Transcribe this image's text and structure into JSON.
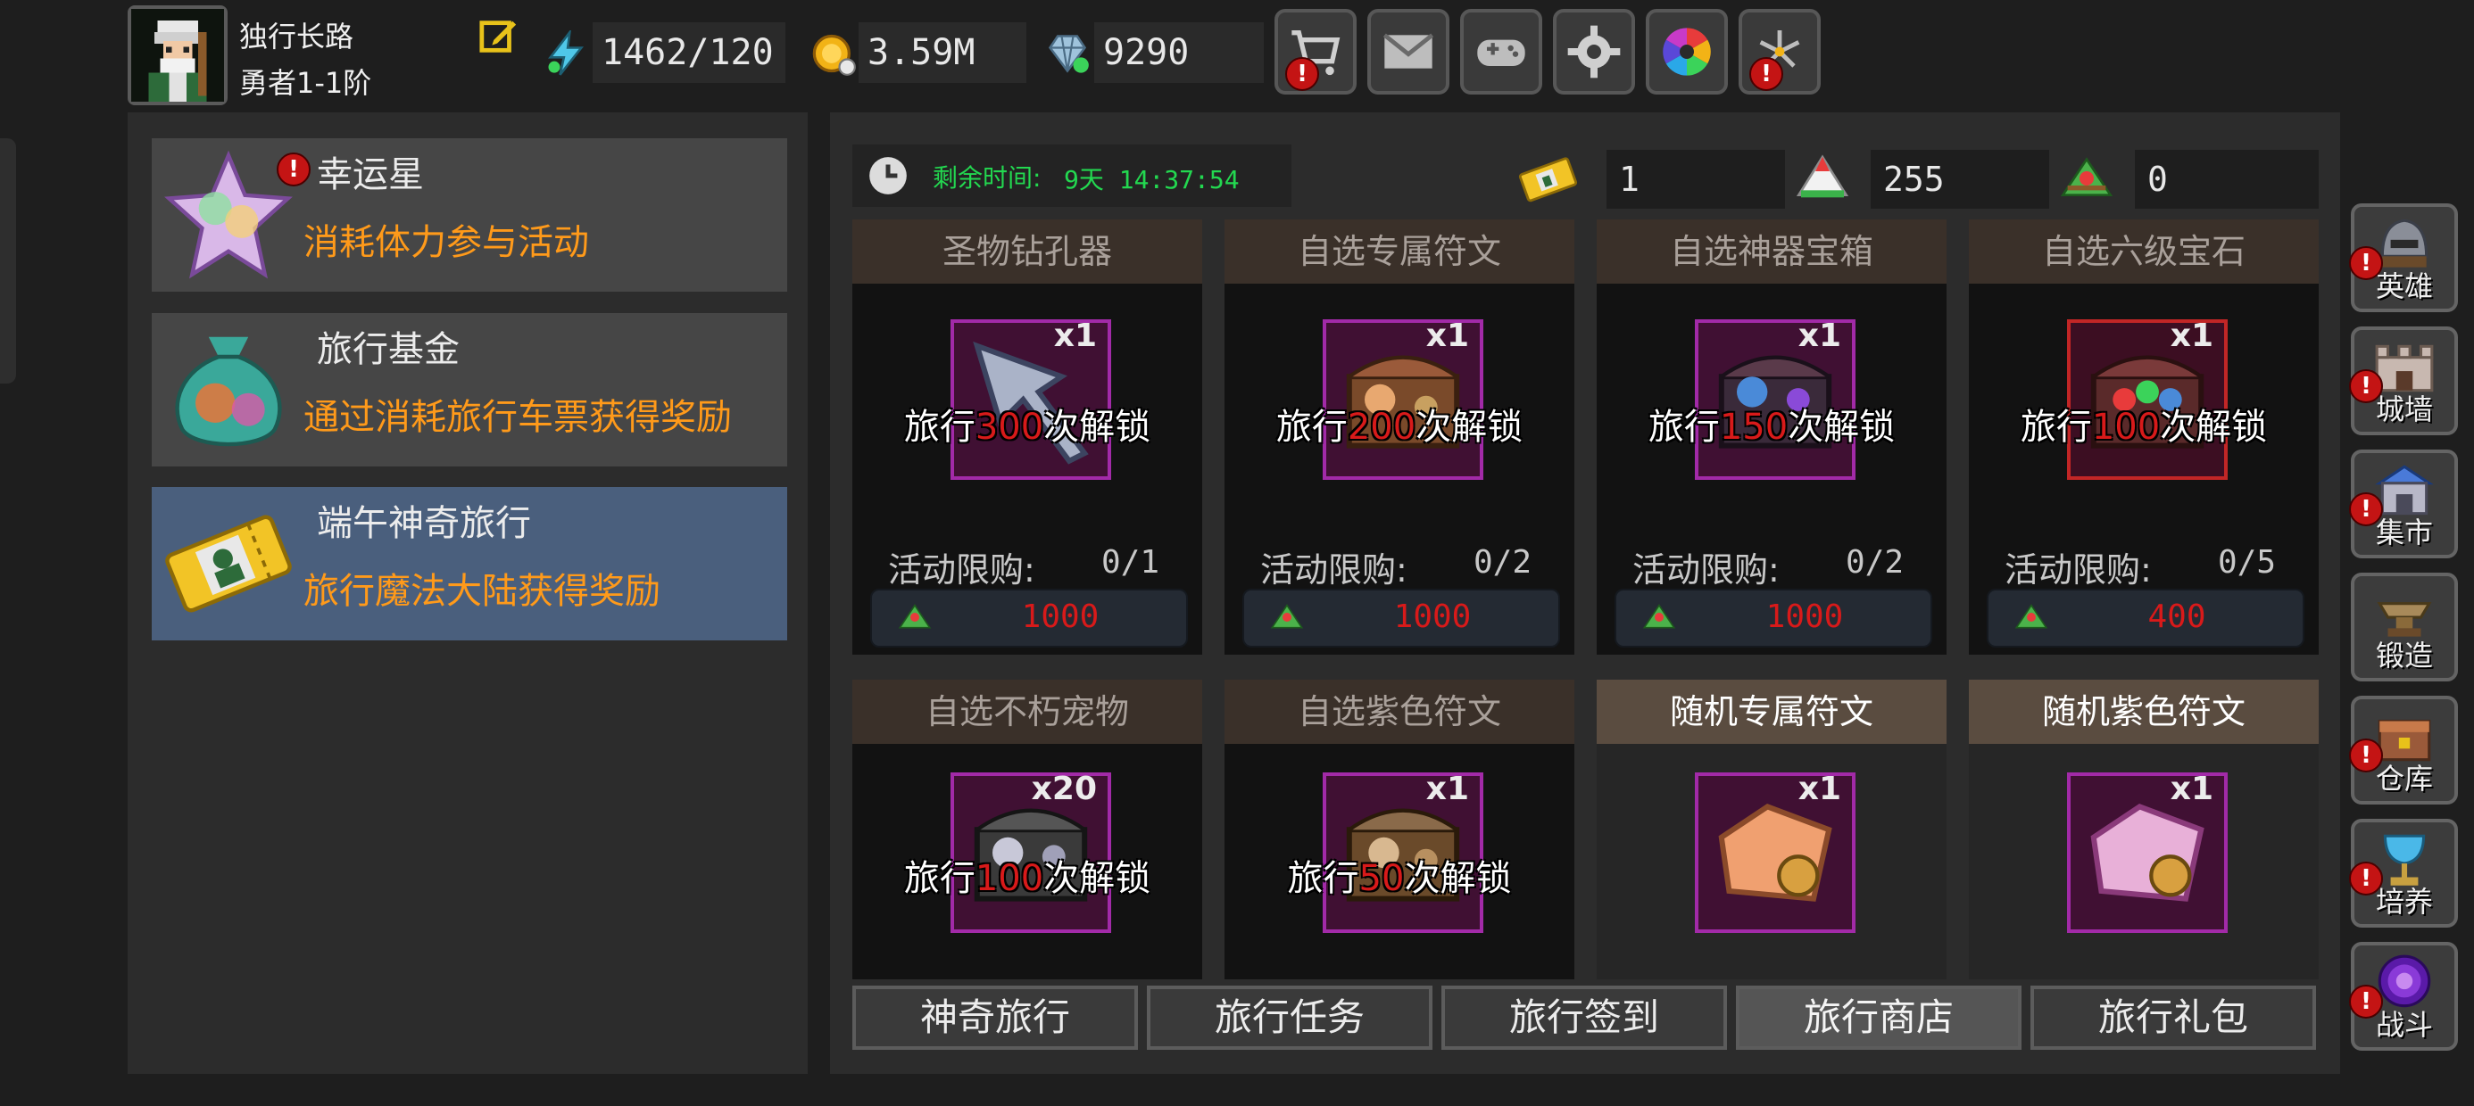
{
  "player": {
    "name": "独行长路",
    "rank": "勇者1-1阶"
  },
  "resources": [
    {
      "icon": "stamina-icon",
      "value": "1462/120"
    },
    {
      "icon": "gold-coin-icon",
      "value": "3.59M"
    },
    {
      "icon": "diamond-icon",
      "value": "9290"
    }
  ],
  "top_buttons": [
    {
      "icon": "cart-icon",
      "alert": "!"
    },
    {
      "icon": "mail-icon",
      "alert": ""
    },
    {
      "icon": "gamepad-icon",
      "alert": ""
    },
    {
      "icon": "settings-gear-icon",
      "alert": ""
    },
    {
      "icon": "color-wheel-icon",
      "alert": ""
    },
    {
      "icon": "fireworks-icon",
      "alert": "!"
    }
  ],
  "events": [
    {
      "title": "幸运星",
      "desc": "消耗体力参与活动",
      "icon": "lucky-star-icon",
      "alert": "!",
      "active": false
    },
    {
      "title": "旅行基金",
      "desc": "通过消耗旅行车票获得奖励",
      "icon": "money-bag-icon",
      "alert": "",
      "active": false
    },
    {
      "title": "端午神奇旅行",
      "desc": "旅行魔法大陆获得奖励",
      "icon": "travel-ticket-icon",
      "alert": "",
      "active": true
    }
  ],
  "timer": {
    "label": "剩余时间:",
    "value": "9天 14:37:54"
  },
  "currencies": [
    {
      "icon": "ticket-icon",
      "value": "1"
    },
    {
      "icon": "rice-dumpling-icon",
      "value": "255"
    },
    {
      "icon": "zongzi-icon",
      "value": "0"
    }
  ],
  "shop_items": [
    {
      "name": "圣物钻孔器",
      "qty": "x1",
      "lock_prefix": "旅行",
      "lock_num": "300",
      "lock_suffix": "次解锁",
      "limit_label": "活动限购:",
      "limit": "0/1",
      "price": "1000",
      "frame": "purple",
      "icon": "drill-icon",
      "highlight": false
    },
    {
      "name": "自选专属符文",
      "qty": "x1",
      "lock_prefix": "旅行",
      "lock_num": "200",
      "lock_suffix": "次解锁",
      "limit_label": "活动限购:",
      "limit": "0/2",
      "price": "1000",
      "frame": "purple",
      "icon": "rune-chest-icon",
      "highlight": false
    },
    {
      "name": "自选神器宝箱",
      "qty": "x1",
      "lock_prefix": "旅行",
      "lock_num": "150",
      "lock_suffix": "次解锁",
      "limit_label": "活动限购:",
      "limit": "0/2",
      "price": "1000",
      "frame": "purple",
      "icon": "artifact-chest-icon",
      "highlight": false
    },
    {
      "name": "自选六级宝石",
      "qty": "x1",
      "lock_prefix": "旅行",
      "lock_num": "100",
      "lock_suffix": "次解锁",
      "limit_label": "活动限购:",
      "limit": "0/5",
      "price": "400",
      "frame": "red",
      "icon": "gem-chest-icon",
      "highlight": false
    },
    {
      "name": "自选不朽宠物",
      "qty": "x20",
      "lock_prefix": "旅行",
      "lock_num": "100",
      "lock_suffix": "次解锁",
      "frame": "purple",
      "icon": "pet-chest-icon",
      "highlight": false
    },
    {
      "name": "自选紫色符文",
      "qty": "x1",
      "lock_prefix": "旅行",
      "lock_num": "50",
      "lock_suffix": "次解锁",
      "frame": "purple",
      "icon": "purple-rune-chest-icon",
      "highlight": false
    },
    {
      "name": "随机专属符文",
      "qty": "x1",
      "frame": "purple",
      "icon": "random-rune-chest-icon",
      "highlight": true
    },
    {
      "name": "随机紫色符文",
      "qty": "x1",
      "frame": "purple",
      "icon": "random-purple-rune-icon",
      "highlight": true
    }
  ],
  "tabs": [
    {
      "label": "神奇旅行",
      "active": false
    },
    {
      "label": "旅行任务",
      "active": false
    },
    {
      "label": "旅行签到",
      "active": false
    },
    {
      "label": "旅行商店",
      "active": true
    },
    {
      "label": "旅行礼包",
      "active": false
    }
  ],
  "side_nav": [
    {
      "label": "英雄",
      "icon": "helmet-icon",
      "alert": "!"
    },
    {
      "label": "城墙",
      "icon": "wall-icon",
      "alert": "!"
    },
    {
      "label": "集市",
      "icon": "market-icon",
      "alert": "!"
    },
    {
      "label": "锻造",
      "icon": "anvil-icon",
      "alert": ""
    },
    {
      "label": "仓库",
      "icon": "warehouse-icon",
      "alert": "!"
    },
    {
      "label": "培养",
      "icon": "chalice-icon",
      "alert": "!"
    },
    {
      "label": "战斗",
      "icon": "portal-icon",
      "alert": "!"
    }
  ],
  "colors": {
    "accent_orange": "#ff9a1a",
    "timer_green": "#23d850",
    "price_red": "#d81a1a",
    "active_event": "#4a5f7d",
    "frame_purple": "#a22aa8",
    "frame_red": "#c22626"
  }
}
